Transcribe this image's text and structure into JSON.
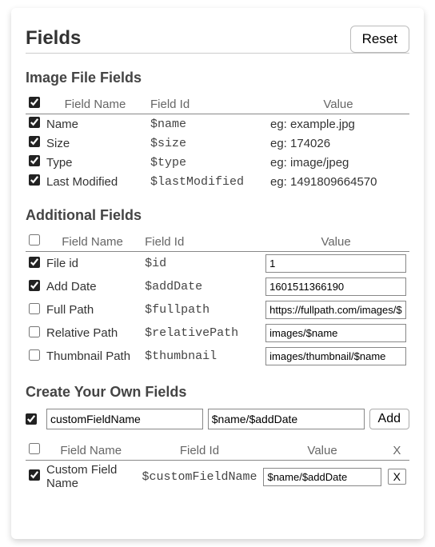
{
  "page": {
    "title": "Fields",
    "reset_label": "Reset"
  },
  "sections": {
    "image_file": {
      "title": "Image File Fields"
    },
    "additional": {
      "title": "Additional Fields"
    },
    "custom": {
      "title": "Create Your Own Fields"
    }
  },
  "headers": {
    "field_name": "Field Name",
    "field_id": "Field Id",
    "value": "Value",
    "x": "X"
  },
  "image_file_fields": {
    "header_checked": true,
    "rows": [
      {
        "checked": true,
        "name": "Name",
        "id": "$name",
        "value": "eg: example.jpg"
      },
      {
        "checked": true,
        "name": "Size",
        "id": "$size",
        "value": "eg: 174026"
      },
      {
        "checked": true,
        "name": "Type",
        "id": "$type",
        "value": "eg: image/jpeg"
      },
      {
        "checked": true,
        "name": "Last Modified",
        "id": "$lastModified",
        "value": "eg: 1491809664570"
      }
    ]
  },
  "additional_fields": {
    "header_checked": false,
    "rows": [
      {
        "checked": true,
        "name": "File id",
        "id": "$id",
        "value": "1"
      },
      {
        "checked": true,
        "name": "Add Date",
        "id": "$addDate",
        "value": "1601511366190"
      },
      {
        "checked": false,
        "name": "Full Path",
        "id": "$fullpath",
        "value": "https://fullpath.com/images/$name"
      },
      {
        "checked": false,
        "name": "Relative Path",
        "id": "$relativePath",
        "value": "images/$name"
      },
      {
        "checked": false,
        "name": "Thumbnail Path",
        "id": "$thumbnail",
        "value": "images/thumbnail/$name"
      }
    ]
  },
  "custom_create": {
    "checked": true,
    "name_input": "customFieldName",
    "value_input": "$name/$addDate",
    "add_label": "Add"
  },
  "custom_fields": {
    "header_checked": false,
    "rows": [
      {
        "checked": true,
        "name": "Custom Field Name",
        "id": "$customFieldName",
        "value": "$name/$addDate",
        "del": "X"
      }
    ]
  }
}
